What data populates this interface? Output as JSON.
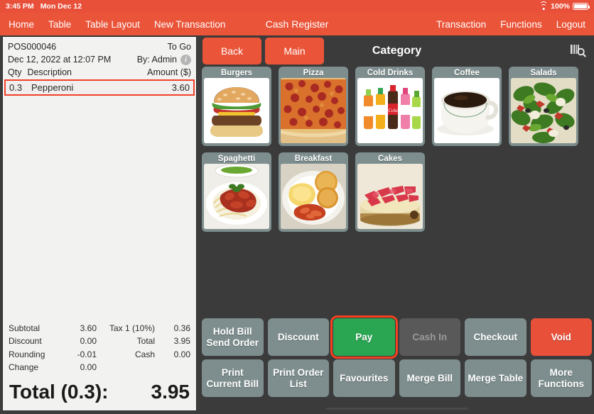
{
  "statusbar": {
    "time": "3:45 PM",
    "date": "Mon Dec 12",
    "battery_percent": "100%",
    "wifi_icon": "wifi-icon",
    "battery_icon": "battery-icon"
  },
  "header": {
    "title": "Cash Register",
    "left_nav": [
      {
        "label": "Home"
      },
      {
        "label": "Table"
      },
      {
        "label": "Table Layout"
      },
      {
        "label": "New Transaction"
      }
    ],
    "right_nav": [
      {
        "label": "Transaction"
      },
      {
        "label": "Functions"
      },
      {
        "label": "Logout"
      }
    ]
  },
  "receipt": {
    "order_id": "POS000046",
    "order_type": "To Go",
    "datetime": "Dec 12, 2022 at 12:07 PM",
    "operator": "By: Admin",
    "info_icon": "info-icon",
    "columns": {
      "qty": "Qty",
      "description": "Description",
      "amount": "Amount ($)"
    },
    "items": [
      {
        "qty": "0.3",
        "description": "Pepperoni",
        "amount": "3.60",
        "selected": true
      }
    ],
    "totals": [
      {
        "label": "Subtotal",
        "value": "3.60",
        "label2": "Tax 1 (10%)",
        "value2": "0.36"
      },
      {
        "label": "Discount",
        "value": "0.00",
        "label2": "Total",
        "value2": "3.95"
      },
      {
        "label": "Rounding",
        "value": "-0.01",
        "label2": "Cash",
        "value2": "0.00"
      },
      {
        "label": "Change",
        "value": "0.00",
        "label2": "",
        "value2": ""
      }
    ],
    "grand_total_label": "Total (0.3):",
    "grand_total_value": "3.95"
  },
  "main": {
    "back_label": "Back",
    "main_label": "Main",
    "category_title": "Category",
    "scan_icon": "barcode-scan-icon",
    "categories": [
      {
        "name": "Burgers",
        "image": "burger-image"
      },
      {
        "name": "Pizza",
        "image": "pizza-image"
      },
      {
        "name": "Cold Drinks",
        "image": "cold-drinks-image"
      },
      {
        "name": "Coffee",
        "image": "coffee-image"
      },
      {
        "name": "Salads",
        "image": "salad-image"
      },
      {
        "name": "Spaghetti",
        "image": "spaghetti-image"
      },
      {
        "name": "Breakfast",
        "image": "breakfast-image"
      },
      {
        "name": "Cakes",
        "image": "cake-image"
      }
    ],
    "actions_row1": [
      {
        "label": "Hold Bill\nSend Order",
        "style": "default",
        "highlight": false
      },
      {
        "label": "Discount",
        "style": "default",
        "highlight": false
      },
      {
        "label": "Pay",
        "style": "green",
        "highlight": true
      },
      {
        "label": "Cash In",
        "style": "disabled",
        "highlight": false
      },
      {
        "label": "Checkout",
        "style": "default",
        "highlight": false
      },
      {
        "label": "Void",
        "style": "red",
        "highlight": false
      }
    ],
    "actions_row2": [
      {
        "label": "Print\nCurrent Bill",
        "style": "default",
        "highlight": false
      },
      {
        "label": "Print Order\nList",
        "style": "default",
        "highlight": false
      },
      {
        "label": "Favourites",
        "style": "default",
        "highlight": false
      },
      {
        "label": "Merge Bill",
        "style": "default",
        "highlight": false
      },
      {
        "label": "Merge Table",
        "style": "default",
        "highlight": false
      },
      {
        "label": "More\nFunctions",
        "style": "default",
        "highlight": false
      }
    ]
  },
  "colors": {
    "brand_red": "#ea5439",
    "status_red": "#e8503a",
    "button_gray": "#7e8e8e",
    "pay_green": "#2aa653",
    "highlight_red": "#f4411f",
    "panel_dark": "#3b3b3b",
    "receipt_bg": "#f2f2f0"
  }
}
